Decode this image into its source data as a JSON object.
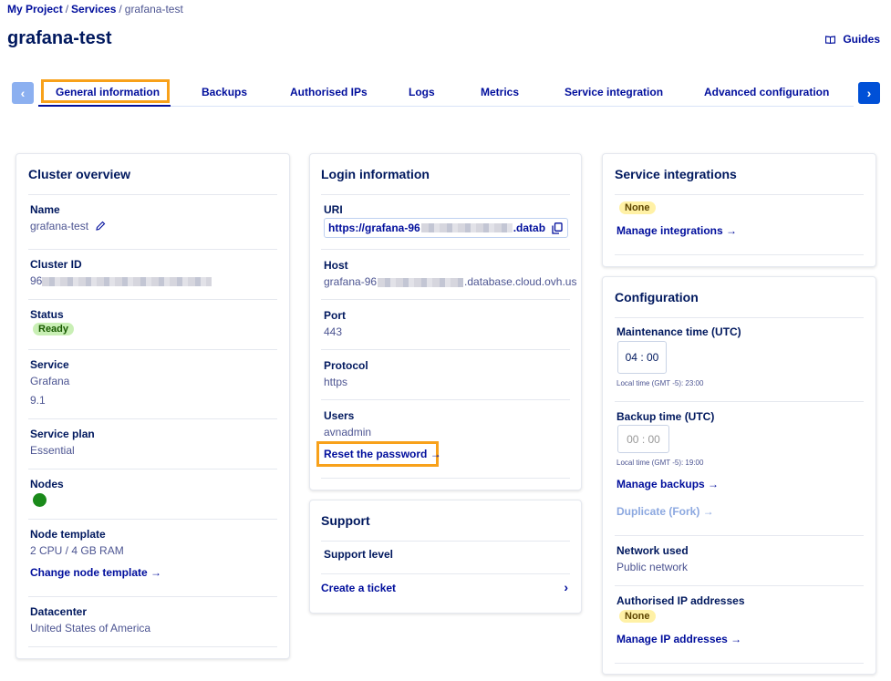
{
  "breadcrumb": {
    "project": "My Project",
    "services": "Services",
    "current": "grafana-test"
  },
  "page_title": "grafana-test",
  "guides_label": "Guides",
  "tabs": {
    "prev": "‹",
    "next": "›",
    "items": [
      "General information",
      "Backups",
      "Authorised IPs",
      "Logs",
      "Metrics",
      "Service integration",
      "Advanced configuration"
    ]
  },
  "cluster": {
    "title": "Cluster overview",
    "name_label": "Name",
    "name_value": "grafana-test",
    "id_label": "Cluster ID",
    "id_value": "96",
    "status_label": "Status",
    "status_value": "Ready",
    "service_label": "Service",
    "service_value": "Grafana",
    "service_version": "9.1",
    "plan_label": "Service plan",
    "plan_value": "Essential",
    "nodes_label": "Nodes",
    "template_label": "Node template",
    "template_value": "2 CPU / 4 GB RAM",
    "template_link": "Change node template →",
    "dc_label": "Datacenter",
    "dc_value": "United States of America"
  },
  "login": {
    "title": "Login information",
    "uri_label": "URI",
    "uri_prefix": "https://grafana-96",
    "uri_suffix": ".datab",
    "host_label": "Host",
    "host_prefix": "grafana-96",
    "host_suffix": ".database.cloud.ovh.us",
    "port_label": "Port",
    "port_value": "443",
    "protocol_label": "Protocol",
    "protocol_value": "https",
    "users_label": "Users",
    "users_value": "avnadmin",
    "reset_link": "Reset the password →"
  },
  "support": {
    "title": "Support",
    "level_label": "Support level",
    "ticket_link": "Create a ticket",
    "chevron": "›"
  },
  "integrations": {
    "title": "Service integrations",
    "badge": "None",
    "manage_link": "Manage integrations →"
  },
  "configuration": {
    "title": "Configuration",
    "maint_label": "Maintenance time (UTC)",
    "maint_hour": "04",
    "maint_min": "00",
    "maint_local": "Local time (GMT -5): 23:00",
    "backup_label": "Backup time (UTC)",
    "backup_hour": "00",
    "backup_min": "00",
    "backup_local": "Local time (GMT -5): 19:00",
    "manage_backups": "Manage backups →",
    "duplicate": "Duplicate (Fork) →",
    "network_label": "Network used",
    "network_value": "Public network",
    "ip_label": "Authorised IP addresses",
    "ip_badge": "None",
    "manage_ip": "Manage IP addresses →"
  },
  "colors": {
    "accent": "#000e9c",
    "highlight": "#f8a11a",
    "title": "#00185e",
    "ready": "#c9efb5",
    "none": "#fff1a6"
  }
}
